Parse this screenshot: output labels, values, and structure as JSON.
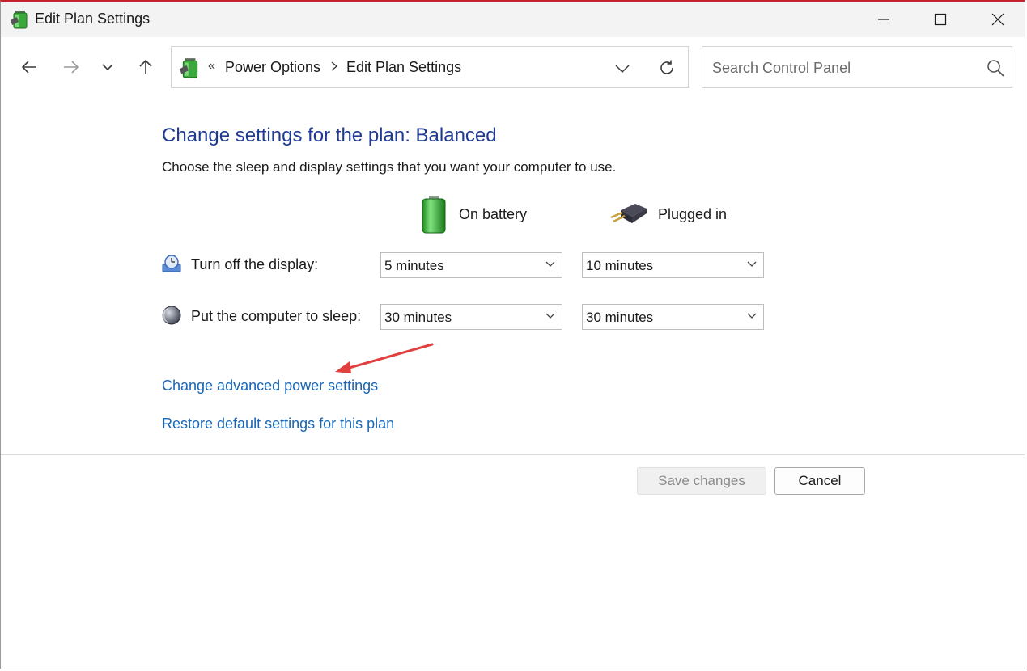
{
  "window": {
    "title": "Edit Plan Settings",
    "accent_color": "#c4212b"
  },
  "titlebar_controls": {
    "minimize_icon": "minimize-icon",
    "maximize_icon": "maximize-icon",
    "close_icon": "close-icon"
  },
  "navigation": {
    "back_icon": "arrow-left-icon",
    "forward_icon": "arrow-right-icon",
    "recent_icon": "chevron-down-icon",
    "up_icon": "arrow-up-icon"
  },
  "address_bar": {
    "overflow": "«",
    "breadcrumbs": [
      "Power Options",
      "Edit Plan Settings"
    ],
    "dropdown_icon": "chevron-down-icon",
    "refresh_icon": "refresh-icon"
  },
  "search": {
    "placeholder": "Search Control Panel",
    "value": "",
    "icon": "search-icon"
  },
  "main": {
    "heading": "Change settings for the plan: Balanced",
    "subtext": "Choose the sleep and display settings that you want your computer to use.",
    "columns": {
      "on_battery": "On battery",
      "plugged_in": "Plugged in"
    },
    "rows": [
      {
        "label": "Turn off the display:",
        "icon": "display-icon",
        "on_battery": "5 minutes",
        "plugged_in": "10 minutes"
      },
      {
        "label": "Put the computer to sleep:",
        "icon": "sleep-moon-icon",
        "on_battery": "30 minutes",
        "plugged_in": "30 minutes"
      }
    ],
    "links": {
      "advanced": "Change advanced power settings",
      "restore": "Restore default settings for this plan"
    }
  },
  "footer": {
    "save_label": "Save changes",
    "cancel_label": "Cancel"
  },
  "colors": {
    "heading": "#1f3a93",
    "link": "#1a66b5",
    "annotation_arrow": "#e04040"
  }
}
